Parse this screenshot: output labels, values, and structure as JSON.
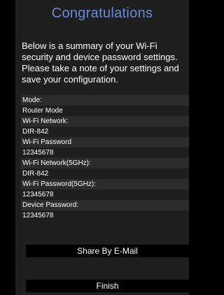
{
  "header": {
    "title": "Congratulations"
  },
  "summary": {
    "text": "Below is a summary of your Wi-Fi security and device password settings. Please take a note of your settings and save your configuration."
  },
  "settings": {
    "mode_label": "Mode:",
    "mode_value": "Router Mode",
    "wifi_network_label": "Wi-Fi Network:",
    "wifi_network_value": "DIR-842",
    "wifi_password_label": "Wi-Fi Password",
    "wifi_password_value": "12345678",
    "wifi_network_5g_label": "Wi-Fi Network(5GHz):",
    "wifi_network_5g_value": "DIR-842",
    "wifi_password_5g_label": "Wi-Fi Password(5GHz):",
    "wifi_password_5g_value": "12345678",
    "device_password_label": "Device Password:",
    "device_password_value": "12345678"
  },
  "actions": {
    "share_label": "Share By E-Mail",
    "finish_label": "Finish"
  },
  "colors": {
    "title": "#6a8ad8",
    "panel": "#1f1f1f",
    "row_shade": "#2c2c2c",
    "button": "#000000"
  }
}
